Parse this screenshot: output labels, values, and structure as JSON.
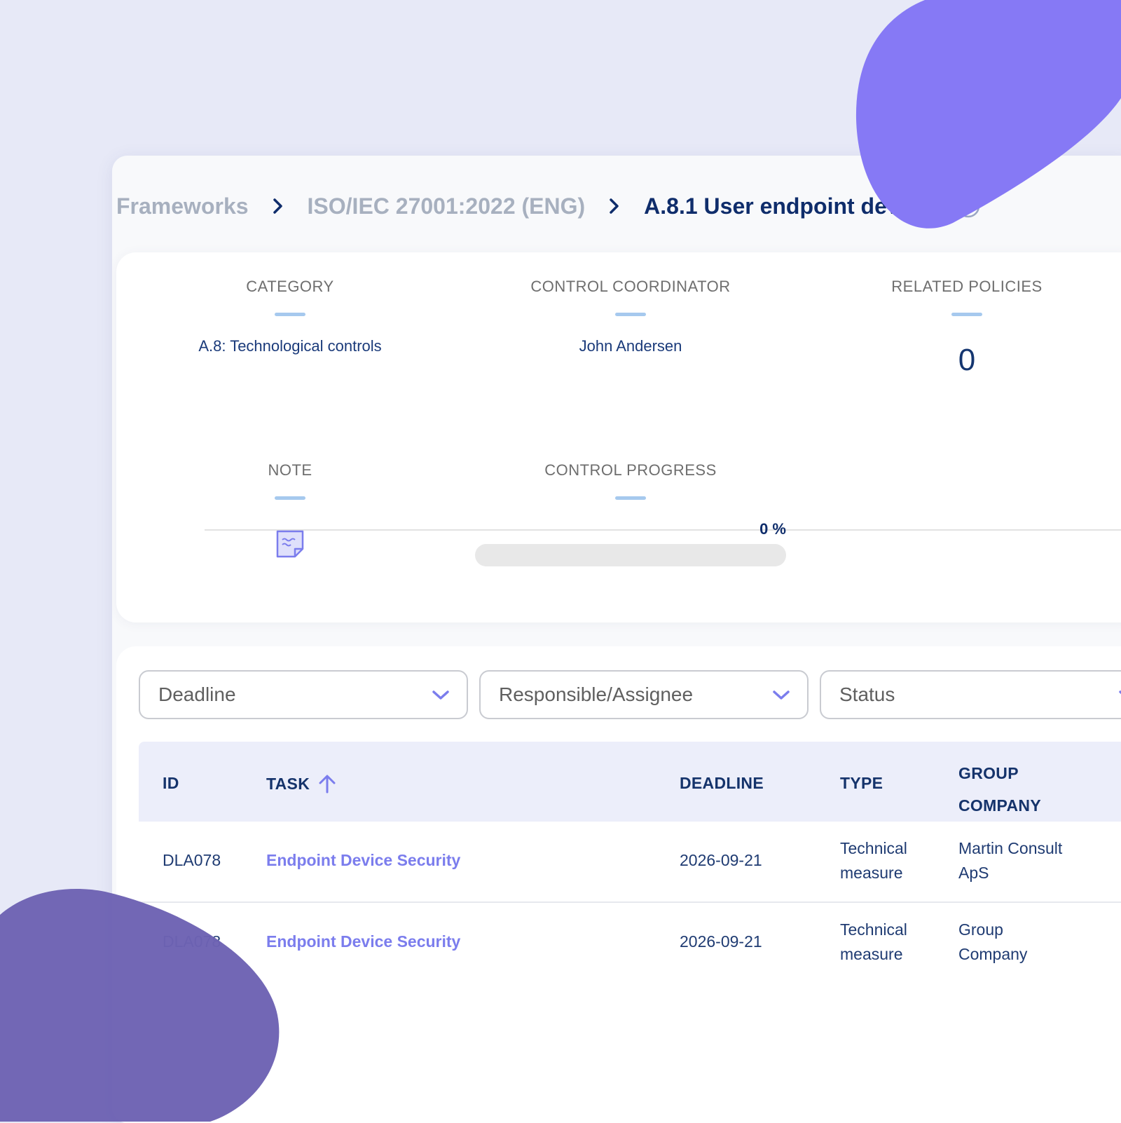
{
  "breadcrumb": {
    "items": [
      "Frameworks",
      "ISO/IEC 27001:2022 (ENG)"
    ],
    "current": "A.8.1 User endpoint devices"
  },
  "control": {
    "category_label": "CATEGORY",
    "category_value": "A.8: Technological controls",
    "coordinator_label": "CONTROL COORDINATOR",
    "coordinator_value": "John Andersen",
    "policies_label": "RELATED POLICIES",
    "policies_value": "0",
    "note_label": "NOTE",
    "progress_label": "CONTROL PROGRESS",
    "progress_value": "0 %",
    "progress_fraction": 0
  },
  "filters": {
    "deadline": "Deadline",
    "assignee": "Responsible/Assignee",
    "status": "Status"
  },
  "table": {
    "headers": {
      "id": "ID",
      "task": "TASK",
      "deadline": "DEADLINE",
      "type": "TYPE",
      "group_company_1": "GROUP",
      "group_company_2": "COMPANY"
    },
    "rows": [
      {
        "id": "DLA078",
        "task": "Endpoint Device Security",
        "deadline": "2026-09-21",
        "type_1": "Technical",
        "type_2": "measure",
        "company_1": "Martin Consult",
        "company_2": "ApS"
      },
      {
        "id": "DLA078",
        "task": "Endpoint Device Security",
        "deadline": "2026-09-21",
        "type_1": "Technical",
        "type_2": "measure",
        "company_1": "Group",
        "company_2": "Company"
      }
    ]
  },
  "colors": {
    "accent": "#7b7ded",
    "navy": "#0f2d6b",
    "blob_top": "#8679f5",
    "blob_bottom": "#6d62b3"
  }
}
